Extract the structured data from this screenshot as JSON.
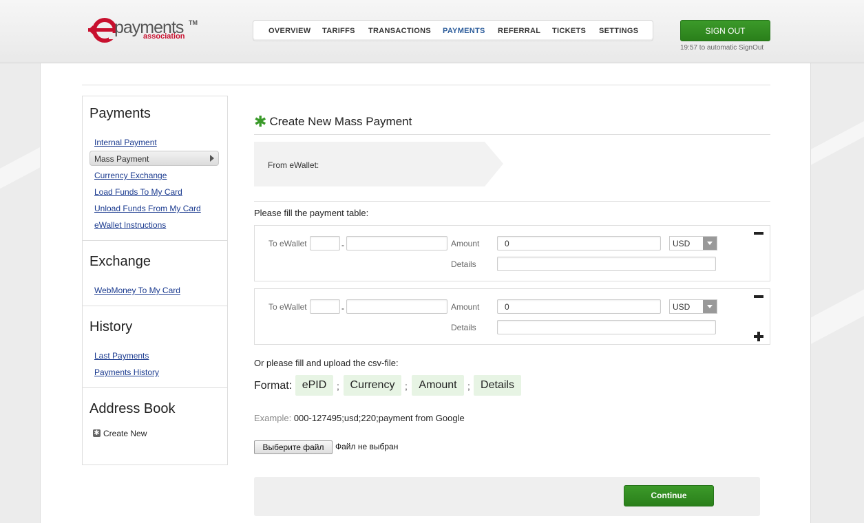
{
  "brand": {
    "wordmark": "payments",
    "tm": "TM",
    "sub": "association",
    "logo_letter": "e"
  },
  "topnav": {
    "items": [
      "OVERVIEW",
      "TARIFFS",
      "TRANSACTIONS",
      "PAYMENTS",
      "REFERRAL",
      "TICKETS",
      "SETTINGS"
    ],
    "active": "PAYMENTS"
  },
  "signout": {
    "label": "SIGN OUT",
    "note": "19:57 to automatic SignOut"
  },
  "sidebar": {
    "payments": {
      "title": "Payments",
      "links": [
        "Internal Payment",
        "Mass Payment",
        "Currency Exchange",
        "Load Funds To My Card",
        "Unload Funds From My Card",
        "eWallet Instructions"
      ],
      "active": "Mass Payment"
    },
    "exchange": {
      "title": "Exchange",
      "links": [
        "WebMoney To My Card"
      ]
    },
    "history": {
      "title": "History",
      "links": [
        "Last Payments",
        "Payments History"
      ]
    },
    "address_book": {
      "title": "Address Book",
      "create": "Create New"
    }
  },
  "main": {
    "title": "Create New Mass Payment",
    "from_label": "From eWallet:",
    "fill_label": "Please fill the payment table:",
    "rows": [
      {
        "to_label": "To eWallet",
        "dash": "-",
        "amount_label": "Amount",
        "amount_value": "0",
        "currency": "USD",
        "details_label": "Details"
      },
      {
        "to_label": "To eWallet",
        "dash": "-",
        "amount_label": "Amount",
        "amount_value": "0",
        "currency": "USD",
        "details_label": "Details"
      }
    ],
    "csv_label": "Or please fill and upload the csv-file:",
    "format_label": "Format:",
    "format_fields": [
      "ePID",
      "Currency",
      "Amount",
      "Details"
    ],
    "separator": ";",
    "example_label": "Example:",
    "example_value": "000-127495;usd;220;payment from Google",
    "file_button": "Выберите файл",
    "file_status": "Файл не выбран",
    "continue": "Continue"
  },
  "colors": {
    "accent_green": "#2f8a20",
    "link_blue": "#1a3a8f",
    "brand_red": "#c8102e",
    "chip_bg": "#e7f4e4"
  }
}
